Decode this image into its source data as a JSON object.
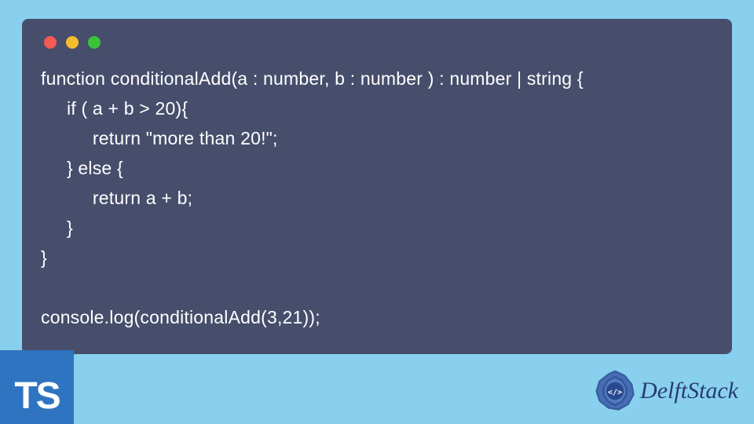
{
  "code": {
    "line1": "function conditionalAdd(a : number, b : number ) : number | string {",
    "line2": "     if ( a + b > 20){",
    "line3": "          return \"more than 20!\";",
    "line4": "     } else {",
    "line5": "          return a + b;",
    "line6": "     }",
    "line7": "}",
    "line8": "",
    "line9": "console.log(conditionalAdd(3,21));"
  },
  "badges": {
    "typescript": "TS",
    "brand": "DelftStack"
  },
  "colors": {
    "page_bg": "#89d0ee",
    "window_bg": "#474e6c",
    "ts_bg": "#2f74c0",
    "text": "#ffffff",
    "brand_text": "#263d6f",
    "traffic_red": "#f45b53",
    "traffic_yellow": "#f7bb2e",
    "traffic_green": "#3ac33a"
  }
}
